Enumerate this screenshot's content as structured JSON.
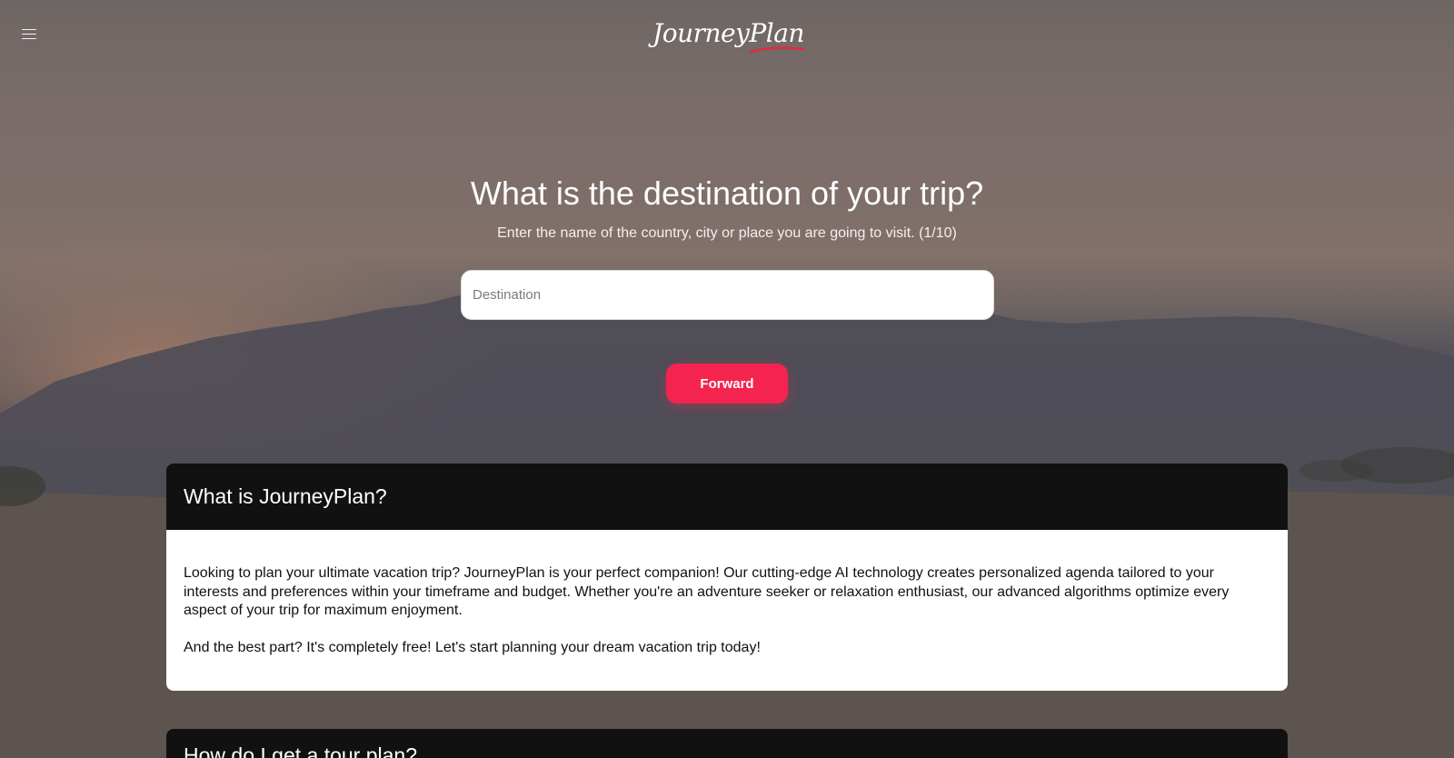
{
  "header": {
    "logo_text": "JourneyPlan"
  },
  "hero": {
    "title": "What is the destination of your trip?",
    "subtitle": "Enter the name of the country, city or place you are going to visit. (1/10)",
    "destination_input": {
      "placeholder": "Destination",
      "value": ""
    },
    "forward_button": "Forward"
  },
  "sections": [
    {
      "title": "What is JourneyPlan?",
      "paragraphs": [
        "Looking to plan your ultimate vacation trip? JourneyPlan is your perfect companion! Our cutting-edge AI technology creates personalized agenda tailored to your interests and preferences within your timeframe and budget. Whether you're an adventure seeker or relaxation enthusiast, our advanced algorithms optimize every aspect of your trip for maximum enjoyment.",
        "And the best part? It's completely free! Let's start planning your dream vacation trip today!"
      ]
    },
    {
      "title": "How do I get a tour plan?"
    }
  ],
  "icons": {
    "menu": "hamburger-menu-icon"
  },
  "colors": {
    "accent": "#f4244f",
    "card_header_bg": "#111111"
  }
}
